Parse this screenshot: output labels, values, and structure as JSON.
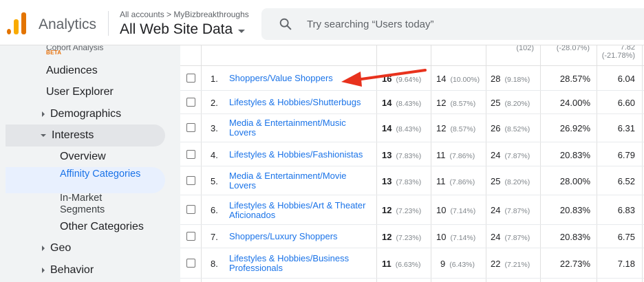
{
  "header": {
    "app_name": "Analytics",
    "breadcrumb": "All accounts > MyBizbreakthroughs",
    "property": "All Web Site Data",
    "search_placeholder": "Try searching “Users today”"
  },
  "sidebar": {
    "partial_top": "Cohort Analysis",
    "beta": "BETA",
    "items": [
      {
        "label": "Audiences"
      },
      {
        "label": "User Explorer"
      },
      {
        "label": "Demographics"
      },
      {
        "label": "Interests"
      },
      {
        "label": "Overview"
      },
      {
        "label": "Affinity Categories"
      },
      {
        "label": "In-Market Segments"
      },
      {
        "label": "Other Categories"
      },
      {
        "label": "Geo"
      },
      {
        "label": "Behavior"
      }
    ]
  },
  "table": {
    "header_values": [
      "(102)",
      "(-28.07%)",
      "7.82",
      "(-21.78%)"
    ],
    "rows": [
      {
        "idx": "1.",
        "name": "Shoppers/Value Shoppers",
        "c1": "16",
        "c1p": "(9.64%)",
        "c2": "14",
        "c2p": "(10.00%)",
        "c3": "28",
        "c3p": "(9.18%)",
        "rate": "28.57%",
        "pages": "6.04"
      },
      {
        "idx": "2.",
        "name": "Lifestyles & Hobbies/Shutterbugs",
        "c1": "14",
        "c1p": "(8.43%)",
        "c2": "12",
        "c2p": "(8.57%)",
        "c3": "25",
        "c3p": "(8.20%)",
        "rate": "24.00%",
        "pages": "6.60"
      },
      {
        "idx": "3.",
        "name": "Media & Entertainment/Music Lovers",
        "c1": "14",
        "c1p": "(8.43%)",
        "c2": "12",
        "c2p": "(8.57%)",
        "c3": "26",
        "c3p": "(8.52%)",
        "rate": "26.92%",
        "pages": "6.31"
      },
      {
        "idx": "4.",
        "name": "Lifestyles & Hobbies/Fashionistas",
        "c1": "13",
        "c1p": "(7.83%)",
        "c2": "11",
        "c2p": "(7.86%)",
        "c3": "24",
        "c3p": "(7.87%)",
        "rate": "20.83%",
        "pages": "6.79"
      },
      {
        "idx": "5.",
        "name": "Media & Entertainment/Movie Lovers",
        "c1": "13",
        "c1p": "(7.83%)",
        "c2": "11",
        "c2p": "(7.86%)",
        "c3": "25",
        "c3p": "(8.20%)",
        "rate": "28.00%",
        "pages": "6.52"
      },
      {
        "idx": "6.",
        "name": "Lifestyles & Hobbies/Art & Theater Aficionados",
        "c1": "12",
        "c1p": "(7.23%)",
        "c2": "10",
        "c2p": "(7.14%)",
        "c3": "24",
        "c3p": "(7.87%)",
        "rate": "20.83%",
        "pages": "6.83"
      },
      {
        "idx": "7.",
        "name": "Shoppers/Luxury Shoppers",
        "c1": "12",
        "c1p": "(7.23%)",
        "c2": "10",
        "c2p": "(7.14%)",
        "c3": "24",
        "c3p": "(7.87%)",
        "rate": "20.83%",
        "pages": "6.75"
      },
      {
        "idx": "8.",
        "name": "Lifestyles & Hobbies/Business Professionals",
        "c1": "11",
        "c1p": "(6.63%)",
        "c2": "9",
        "c2p": "(6.43%)",
        "c3": "22",
        "c3p": "(7.21%)",
        "rate": "22.73%",
        "pages": "7.18"
      }
    ]
  },
  "colors": {
    "accent": "#1a73e8",
    "annotation_arrow": "#e8321d",
    "logo_orange": "#e37400",
    "logo_yellow": "#f9ab00"
  }
}
